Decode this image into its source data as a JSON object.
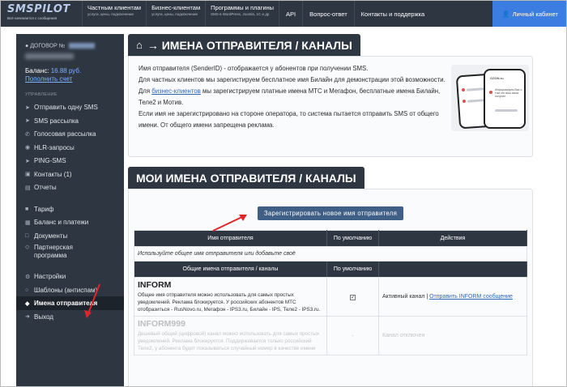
{
  "logo": {
    "name": "SMSPILOT",
    "tagline": "Всё начинается с сообщения"
  },
  "nav": {
    "items": [
      {
        "title": "Частным клиентам",
        "sub": "услуги, цены, подключение"
      },
      {
        "title": "Бизнес-клиентам",
        "sub": "услуги, цены, подключение"
      },
      {
        "title": "Программы и плагины",
        "sub": "SMS в WordPress, Joomla, 1C и др"
      }
    ],
    "api": "API",
    "faq": "Вопрос-ответ",
    "contacts": "Контакты и поддержка",
    "cabinet": "Личный кабинет"
  },
  "sidebar": {
    "contract_label": "ДОГОВОР №",
    "balance_label": "Баланс:",
    "balance_value": "16.88 руб.",
    "topup": "Пополнить счет",
    "section_manage": "УПРАВЛЕНИЕ",
    "items": [
      {
        "label": "Отправить одну SMS",
        "icon": "paper-plane-icon"
      },
      {
        "label": "SMS рассылка",
        "icon": "paper-plane-icon"
      },
      {
        "label": "Голосовая рассылка",
        "icon": "phone-icon"
      },
      {
        "label": "HLR-запросы",
        "icon": "search-icon"
      },
      {
        "label": "PING-SMS",
        "icon": "ping-icon"
      },
      {
        "label": "Контакты (1)",
        "icon": "contacts-icon"
      },
      {
        "label": "Отчеты",
        "icon": "report-icon"
      }
    ],
    "items2": [
      {
        "label": "Тариф",
        "icon": "tariff-icon"
      },
      {
        "label": "Баланс и платежи",
        "icon": "balance-icon"
      },
      {
        "label": "Документы",
        "icon": "document-icon"
      },
      {
        "label": "Партнерская программа",
        "icon": "partner-icon"
      }
    ],
    "items3": [
      {
        "label": "Настройки",
        "icon": "gear-icon"
      },
      {
        "label": "Шаблоны (антиспам)",
        "icon": "template-icon"
      },
      {
        "label": "Имена отправителя",
        "icon": "tag-icon"
      },
      {
        "label": "Выход",
        "icon": "exit-icon"
      }
    ]
  },
  "page": {
    "title": "→ ИМЕНА ОТПРАВИТЕЛЯ / КАНАЛЫ",
    "p1": "Имя отправителя (SenderID) - отображается у абонентов при получении SMS.",
    "p2": "Для частных клиентов мы зарегистируем бесплатное имя Билайн для демонстрации этой возможности.",
    "p3_pre": "Для",
    "p3_link": "бизнес-клиентов",
    "p3_post": "мы зарегистрируем платные имена МТС и Мегафон, бесплатные имена Билайн, Теле2 и Мотив.",
    "p4": "Если имя не зарегистрировано на стороне оператора, то система пытается отправить SMS от общего имени. От общего имени запрещена реклама.",
    "phone": {
      "name": "OZON.ru",
      "msg": "Информируем Вас о том что ваш заказ получен"
    }
  },
  "my_names": {
    "title": "МОИ ИМЕНА ОТПРАВИТЕЛЯ / КАНАЛЫ",
    "register_button": "Зарегистрировать новое имя отправителя",
    "headers": [
      "Имя отправителя",
      "По умолчанию",
      "Действия"
    ],
    "note": "Используйте общее имя отправителя или добавьте своё",
    "common_header": "Общие имена отправителя / каналы",
    "common_default": "По умолчанию",
    "rows": [
      {
        "name": "INFORM",
        "desc": "Общее имя отправителя можно использовать для самых простых уведомлений. Реклама блокируется. У российских абонентов МТС отобразиться - RusNovo.ru, Мегафон - IPS3.ru, Билайн - IPS, Теле2 - IPS3.ru.",
        "checked": "✓",
        "status": "Активный канал",
        "sep": "|",
        "action": "Отправить INFORM сообщение"
      },
      {
        "name": "INFORM999",
        "desc": "Дешевый общий (цифровой) канал можно использовать для самых простых уведомлений. Реклама блокируется. Поддерживается только российский Теле2, у абонента будет показываться случайный номер в качестве имени",
        "checked": "-",
        "status": "Канал отключен",
        "sep": "",
        "action": ""
      }
    ]
  }
}
